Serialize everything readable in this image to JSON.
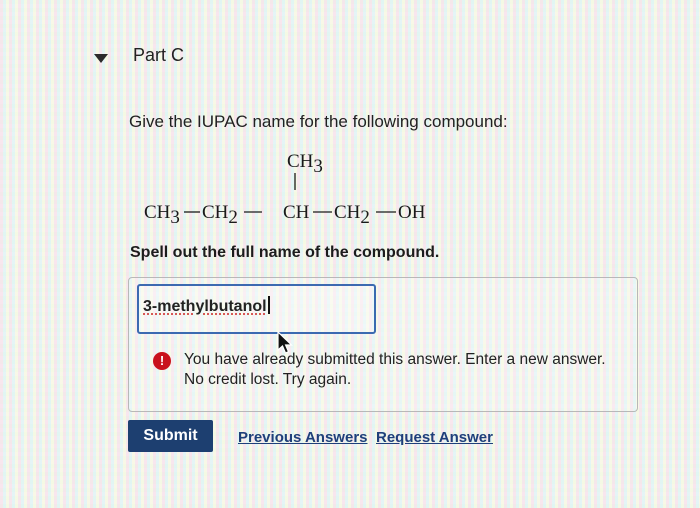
{
  "part": {
    "title": "Part C"
  },
  "question": {
    "text": "Give the IUPAC name for the following compound:"
  },
  "structure": {
    "branch": {
      "main": "CH",
      "sub": "3"
    },
    "chain": [
      {
        "main": "CH",
        "sub": "3"
      },
      {
        "main": "CH",
        "sub": "2"
      },
      {
        "main": "CH",
        "sub": ""
      },
      {
        "main": "CH",
        "sub": "2"
      },
      {
        "main": "OH",
        "sub": ""
      }
    ]
  },
  "instruction": {
    "text": "Spell out the full name of the compound."
  },
  "answer": {
    "value": "3-methylbutanol"
  },
  "feedback": {
    "icon": "alert-icon",
    "icon_glyph": "!",
    "text": "You have already submitted this answer. Enter a new answer. No credit lost. Try again."
  },
  "actions": {
    "submit_label": "Submit",
    "previous_answers_label": "Previous Answers",
    "request_answer_label": "Request Answer"
  },
  "colors": {
    "input_border": "#3b6ab0",
    "submit_background": "#1d3f70",
    "link": "#1f3f7a",
    "alert": "#c9121c"
  }
}
